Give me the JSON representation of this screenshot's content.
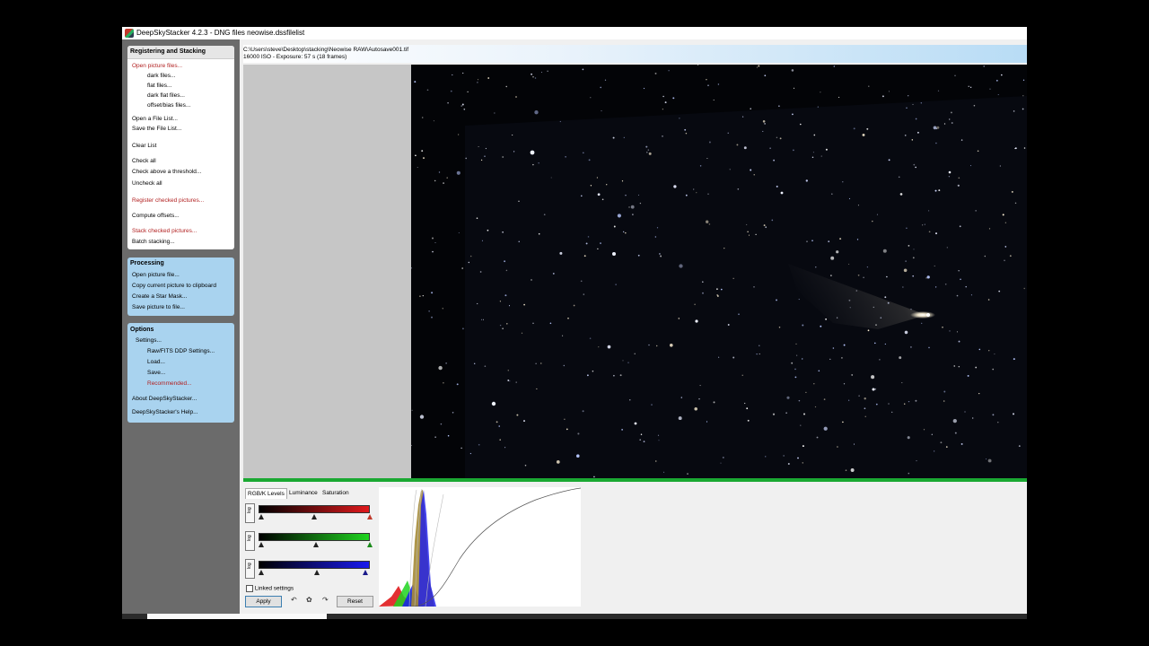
{
  "window": {
    "title": "DeepSkyStacker 4.2.3 - DNG files neowise.dssfilelist"
  },
  "sidebar": {
    "registering": {
      "title": "Registering and Stacking",
      "items": [
        {
          "label": "Open picture files...",
          "red": true,
          "indent": false
        },
        {
          "label": "dark files...",
          "red": false,
          "indent": true
        },
        {
          "label": "flat files...",
          "red": false,
          "indent": true
        },
        {
          "label": "dark flat files...",
          "red": false,
          "indent": true
        },
        {
          "label": "offset/bias files...",
          "red": false,
          "indent": true
        },
        {
          "label": "Open a File List...",
          "red": false,
          "indent": false
        },
        {
          "label": "Save the File List...",
          "red": false,
          "indent": false
        },
        {
          "label": "Clear List",
          "red": false,
          "indent": false
        },
        {
          "label": "Check all",
          "red": false,
          "indent": false
        },
        {
          "label": "Check above a threshold...",
          "red": false,
          "indent": false
        },
        {
          "label": "Uncheck all",
          "red": false,
          "indent": false
        },
        {
          "label": "Register checked pictures...",
          "red": true,
          "indent": false
        },
        {
          "label": "Compute offsets...",
          "red": false,
          "indent": false
        },
        {
          "label": "Stack checked pictures...",
          "red": true,
          "indent": false
        },
        {
          "label": "Batch stacking...",
          "red": false,
          "indent": false
        }
      ]
    },
    "processing": {
      "title": "Processing",
      "items": [
        {
          "label": "Open picture file..."
        },
        {
          "label": "Copy current picture to clipboard"
        },
        {
          "label": "Create a Star Mask..."
        },
        {
          "label": "Save picture to file..."
        }
      ]
    },
    "options": {
      "title": "Options",
      "items": [
        {
          "label": "Settings...",
          "level": 1,
          "red": false
        },
        {
          "label": "Raw/FITS DDP Settings...",
          "level": 2,
          "red": false
        },
        {
          "label": "Load...",
          "level": 2,
          "red": false
        },
        {
          "label": "Save...",
          "level": 2,
          "red": false
        },
        {
          "label": "Recommended...",
          "level": 2,
          "red": true
        },
        {
          "label": "About DeepSkyStacker...",
          "level": 0,
          "red": false
        },
        {
          "label": "DeepSkyStacker's Help...",
          "level": 0,
          "red": false
        }
      ]
    }
  },
  "info": {
    "path": "C:\\Users\\steve\\Desktop\\stacking\\Neowise RAW\\Autosave001.tif",
    "details": "16000 ISO - Exposure: 57 s (18 frames)"
  },
  "levels": {
    "tabs": [
      {
        "label": "RGB/K Levels",
        "active": true
      },
      {
        "label": "Luminance",
        "active": false
      },
      {
        "label": "Saturation",
        "active": false
      }
    ],
    "log_label": "log",
    "channels": [
      {
        "name": "red",
        "color": "#e0191c",
        "black": 0.0,
        "mid": 0.49,
        "white": 1.0
      },
      {
        "name": "green",
        "color": "#1ed41e",
        "black": 0.0,
        "mid": 0.51,
        "white": 1.0
      },
      {
        "name": "blue",
        "color": "#1a1aee",
        "black": 0.0,
        "mid": 0.51,
        "white": 0.94
      }
    ],
    "linked_settings": {
      "label": "Linked settings",
      "checked": false
    },
    "apply_label": "Apply",
    "reset_label": "Reset",
    "icons": [
      "undo-icon",
      "settings-icon",
      "redo-icon"
    ]
  },
  "colors": {
    "accent_green": "#1aa832",
    "panel_blue": "#a9d3ef",
    "sidebar_gray": "#6b6b6b",
    "link_red": "#b22222"
  }
}
